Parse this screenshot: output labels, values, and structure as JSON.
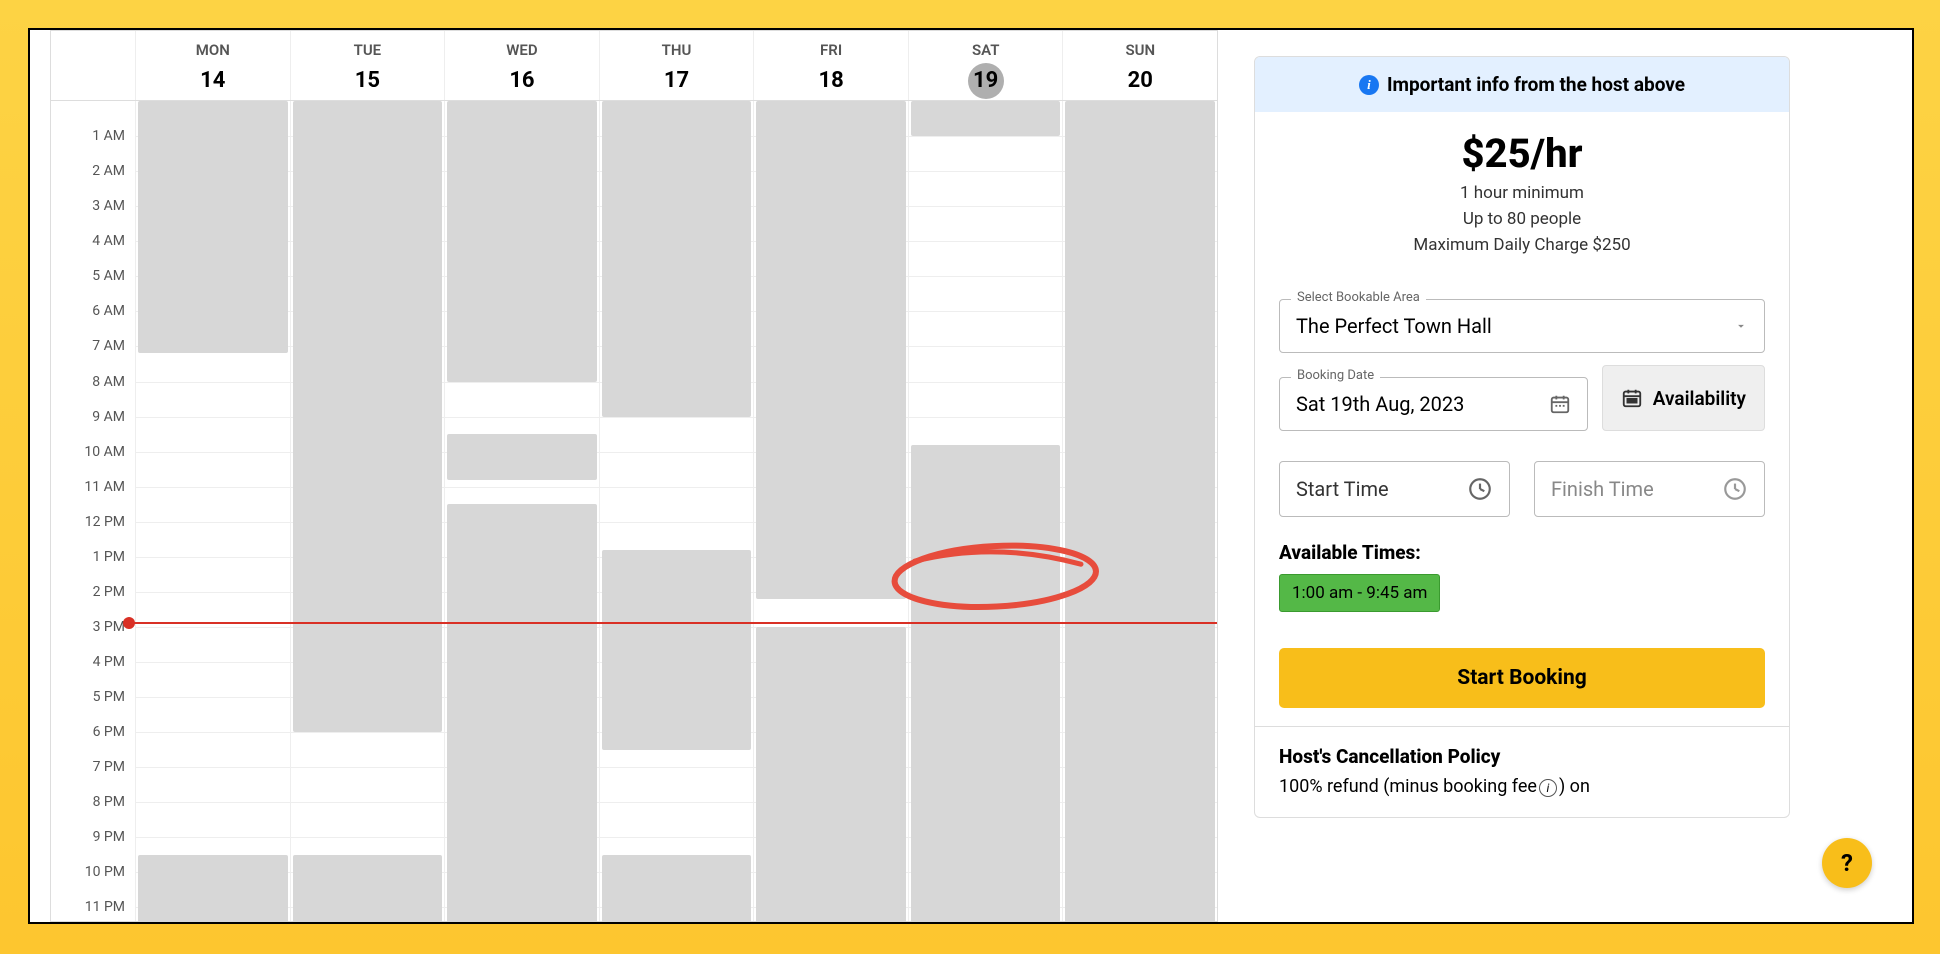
{
  "calendar": {
    "days": [
      {
        "abbr": "MON",
        "num": "14",
        "today": false
      },
      {
        "abbr": "TUE",
        "num": "15",
        "today": false
      },
      {
        "abbr": "WED",
        "num": "16",
        "today": false
      },
      {
        "abbr": "THU",
        "num": "17",
        "today": false
      },
      {
        "abbr": "FRI",
        "num": "18",
        "today": false
      },
      {
        "abbr": "SAT",
        "num": "19",
        "today": true
      },
      {
        "abbr": "SUN",
        "num": "20",
        "today": false
      }
    ],
    "hours": [
      "1 AM",
      "2 AM",
      "3 AM",
      "4 AM",
      "5 AM",
      "6 AM",
      "7 AM",
      "8 AM",
      "9 AM",
      "10 AM",
      "11 AM",
      "12 PM",
      "1 PM",
      "2 PM",
      "3 PM",
      "4 PM",
      "5 PM",
      "6 PM",
      "7 PM",
      "8 PM",
      "9 PM",
      "10 PM",
      "11 PM"
    ],
    "now_hour": 14.85,
    "blocks": [
      {
        "day": 0,
        "start": 0,
        "end": 7.2
      },
      {
        "day": 0,
        "start": 21.5,
        "end": 24
      },
      {
        "day": 1,
        "start": 0,
        "end": 18
      },
      {
        "day": 1,
        "start": 21.5,
        "end": 24
      },
      {
        "day": 2,
        "start": 0,
        "end": 8
      },
      {
        "day": 2,
        "start": 9.5,
        "end": 10.8
      },
      {
        "day": 2,
        "start": 11.5,
        "end": 24
      },
      {
        "day": 3,
        "start": 0,
        "end": 9
      },
      {
        "day": 3,
        "start": 12.8,
        "end": 18.5
      },
      {
        "day": 3,
        "start": 21.5,
        "end": 24
      },
      {
        "day": 4,
        "start": 0,
        "end": 14.2
      },
      {
        "day": 4,
        "start": 15,
        "end": 24
      },
      {
        "day": 5,
        "start": 0,
        "end": 1
      },
      {
        "day": 5,
        "start": 9.8,
        "end": 24
      },
      {
        "day": 6,
        "start": 0,
        "end": 24
      }
    ]
  },
  "booking": {
    "banner": "Important info from the host above",
    "price": "$25/hr",
    "min": "1 hour minimum",
    "people": "Up to 80 people",
    "maxcharge": "Maximum Daily Charge $250",
    "area_label": "Select Bookable Area",
    "area_value": "The Perfect Town Hall",
    "date_label": "Booking Date",
    "date_value": "Sat 19th Aug, 2023",
    "avail_btn": "Availability",
    "start_placeholder": "Start Time",
    "finish_placeholder": "Finish Time",
    "avail_title": "Available Times:",
    "avail_chip": "1:00 am - 9:45 am",
    "start_btn": "Start Booking",
    "policy_title": "Host's Cancellation Policy",
    "policy_text_1": "100% refund (minus booking fee",
    "policy_text_2": ") on"
  },
  "help": "?"
}
